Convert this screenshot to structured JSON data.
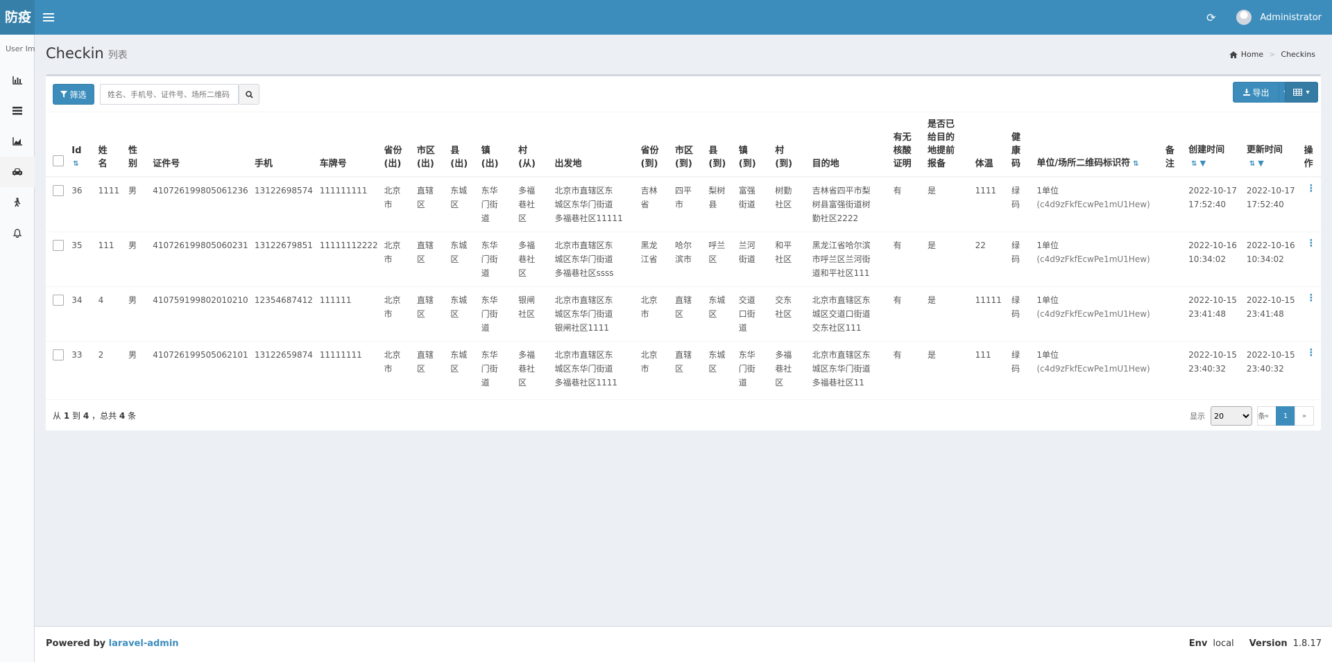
{
  "app": {
    "logo": "防疫",
    "admin_name": "Administrator"
  },
  "sidebar": {
    "user_image_alt": "User Image"
  },
  "page": {
    "title": "Checkin",
    "subtitle": "列表"
  },
  "breadcrumb": {
    "home": "Home",
    "current": "Checkins"
  },
  "toolbar": {
    "filter_label": "筛选",
    "search_placeholder": "姓名、手机号、证件号、场所二维码",
    "export_label": "导出"
  },
  "table": {
    "headers": {
      "id": "Id",
      "name": [
        "姓",
        "名"
      ],
      "gender": [
        "性",
        "别"
      ],
      "idcard": "证件号",
      "phone": "手机",
      "plate": "车牌号",
      "prov_from": [
        "省份",
        "(出)"
      ],
      "city_from": [
        "市区",
        "(出)"
      ],
      "county_from": [
        "县",
        "(出)"
      ],
      "town_from": [
        "镇",
        "(出)"
      ],
      "village_from": [
        "村",
        "(从)"
      ],
      "origin": "出发地",
      "prov_to": [
        "省份",
        "(到)"
      ],
      "city_to": [
        "市区",
        "(到)"
      ],
      "county_to": [
        "县",
        "(到)"
      ],
      "town_to": [
        "镇",
        "(到)"
      ],
      "village_to": [
        "村",
        "(到)"
      ],
      "destination": "目的地",
      "nucleic": [
        "有无",
        "核酸",
        "证明"
      ],
      "reported": [
        "是否已",
        "给目的",
        "地提前",
        "报备"
      ],
      "temp": "体温",
      "health": [
        "健",
        "康",
        "码"
      ],
      "unit": "单位/场所二维码标识符",
      "remark": [
        "备",
        "注"
      ],
      "created": "创建时间",
      "updated": "更新时间",
      "action": [
        "操",
        "作"
      ]
    },
    "rows": [
      {
        "id": "36",
        "name": "1111",
        "gender": "男",
        "idcard": "410726199805061236",
        "phone": "13122698574",
        "plate": "111111111",
        "prov_from": [
          "北京",
          "市"
        ],
        "city_from": [
          "直辖",
          "区"
        ],
        "county_from": [
          "东城",
          "区"
        ],
        "town_from": [
          "东华",
          "门街",
          "道"
        ],
        "village_from": [
          "多福",
          "巷社",
          "区"
        ],
        "origin": [
          "北京市直辖区东",
          "城区东华门街道",
          "多福巷社区11111"
        ],
        "prov_to": [
          "吉林",
          "省"
        ],
        "city_to": [
          "四平",
          "市"
        ],
        "county_to": [
          "梨树",
          "县"
        ],
        "town_to": [
          "富强",
          "街道"
        ],
        "village_to": [
          "树勤",
          "社区"
        ],
        "destination": [
          "吉林省四平市梨",
          "树县富强街道树",
          "勤社区2222"
        ],
        "nucleic": "有",
        "reported": "是",
        "temp": "1111",
        "health": [
          "绿",
          "码"
        ],
        "unit": [
          "1单位",
          "(c4d9zFkfEcwPe1mU1Hew)"
        ],
        "created": [
          "2022-10-17",
          "17:52:40"
        ],
        "updated": [
          "2022-10-17",
          "17:52:40"
        ]
      },
      {
        "id": "35",
        "name": "111",
        "gender": "男",
        "idcard": "410726199805060231",
        "phone": "13122679851",
        "plate": "11111112222",
        "prov_from": [
          "北京",
          "市"
        ],
        "city_from": [
          "直辖",
          "区"
        ],
        "county_from": [
          "东城",
          "区"
        ],
        "town_from": [
          "东华",
          "门街",
          "道"
        ],
        "village_from": [
          "多福",
          "巷社",
          "区"
        ],
        "origin": [
          "北京市直辖区东",
          "城区东华门街道",
          "多福巷社区ssss"
        ],
        "prov_to": [
          "黑龙",
          "江省"
        ],
        "city_to": [
          "哈尔",
          "滨市"
        ],
        "county_to": [
          "呼兰",
          "区"
        ],
        "town_to": [
          "兰河",
          "街道"
        ],
        "village_to": [
          "和平",
          "社区"
        ],
        "destination": [
          "黑龙江省哈尔滨",
          "市呼兰区兰河街",
          "道和平社区111"
        ],
        "nucleic": "有",
        "reported": "是",
        "temp": "22",
        "health": [
          "绿",
          "码"
        ],
        "unit": [
          "1单位",
          "(c4d9zFkfEcwPe1mU1Hew)"
        ],
        "created": [
          "2022-10-16",
          "10:34:02"
        ],
        "updated": [
          "2022-10-16",
          "10:34:02"
        ]
      },
      {
        "id": "34",
        "name": "4",
        "gender": "男",
        "idcard": "410759199802010210",
        "phone": "12354687412",
        "plate": "111111",
        "prov_from": [
          "北京",
          "市"
        ],
        "city_from": [
          "直辖",
          "区"
        ],
        "county_from": [
          "东城",
          "区"
        ],
        "town_from": [
          "东华",
          "门街",
          "道"
        ],
        "village_from": [
          "银闸",
          "社区"
        ],
        "origin": [
          "北京市直辖区东",
          "城区东华门街道",
          "银闸社区1111"
        ],
        "prov_to": [
          "北京",
          "市"
        ],
        "city_to": [
          "直辖",
          "区"
        ],
        "county_to": [
          "东城",
          "区"
        ],
        "town_to": [
          "交道",
          "口街",
          "道"
        ],
        "village_to": [
          "交东",
          "社区"
        ],
        "destination": [
          "北京市直辖区东",
          "城区交道口街道",
          "交东社区111"
        ],
        "nucleic": "有",
        "reported": "是",
        "temp": "11111",
        "health": [
          "绿",
          "码"
        ],
        "unit": [
          "1单位",
          "(c4d9zFkfEcwPe1mU1Hew)"
        ],
        "created": [
          "2022-10-15",
          "23:41:48"
        ],
        "updated": [
          "2022-10-15",
          "23:41:48"
        ]
      },
      {
        "id": "33",
        "name": "2",
        "gender": "男",
        "idcard": "410726199505062101",
        "phone": "13122659874",
        "plate": "11111111",
        "prov_from": [
          "北京",
          "市"
        ],
        "city_from": [
          "直辖",
          "区"
        ],
        "county_from": [
          "东城",
          "区"
        ],
        "town_from": [
          "东华",
          "门街",
          "道"
        ],
        "village_from": [
          "多福",
          "巷社",
          "区"
        ],
        "origin": [
          "北京市直辖区东",
          "城区东华门街道",
          "多福巷社区1111"
        ],
        "prov_to": [
          "北京",
          "市"
        ],
        "city_to": [
          "直辖",
          "区"
        ],
        "county_to": [
          "东城",
          "区"
        ],
        "town_to": [
          "东华",
          "门街",
          "道"
        ],
        "village_to": [
          "多福",
          "巷社",
          "区"
        ],
        "destination": [
          "北京市直辖区东",
          "城区东华门街道",
          "多福巷社区11"
        ],
        "nucleic": "有",
        "reported": "是",
        "temp": "111",
        "health": [
          "绿",
          "码"
        ],
        "unit": [
          "1单位",
          "(c4d9zFkfEcwPe1mU1Hew)"
        ],
        "created": [
          "2022-10-15",
          "23:40:32"
        ],
        "updated": [
          "2022-10-15",
          "23:40:32"
        ]
      }
    ]
  },
  "pagination": {
    "summary_prefix": "从",
    "from": "1",
    "summary_mid": "到",
    "to": "4",
    "summary_total_prefix": "，总共",
    "total": "4",
    "summary_suffix": "条",
    "show_label": "显示",
    "per_page": "20",
    "per_page_suffix": "条",
    "prev": "«",
    "current_page": "1",
    "next": "»"
  },
  "footer": {
    "powered_by": "Powered by",
    "powered_link": "laravel-admin",
    "env_label": "Env",
    "env_value": "local",
    "version_label": "Version",
    "version_value": "1.8.17"
  },
  "colors": {
    "navbar": "#3c8dbc",
    "logo_bg": "#367fa9",
    "accent": "#3c8dbc",
    "body_bg": "#ecf0f5"
  },
  "icons": [
    "menu-icon",
    "refresh-icon",
    "bar-chart-icon",
    "list-icon",
    "area-chart-icon",
    "car-icon",
    "walking-icon",
    "bell-icon",
    "home-icon",
    "filter-icon",
    "search-icon",
    "download-icon",
    "table-icon",
    "sort-icon",
    "column-filter-icon",
    "more-icon"
  ]
}
